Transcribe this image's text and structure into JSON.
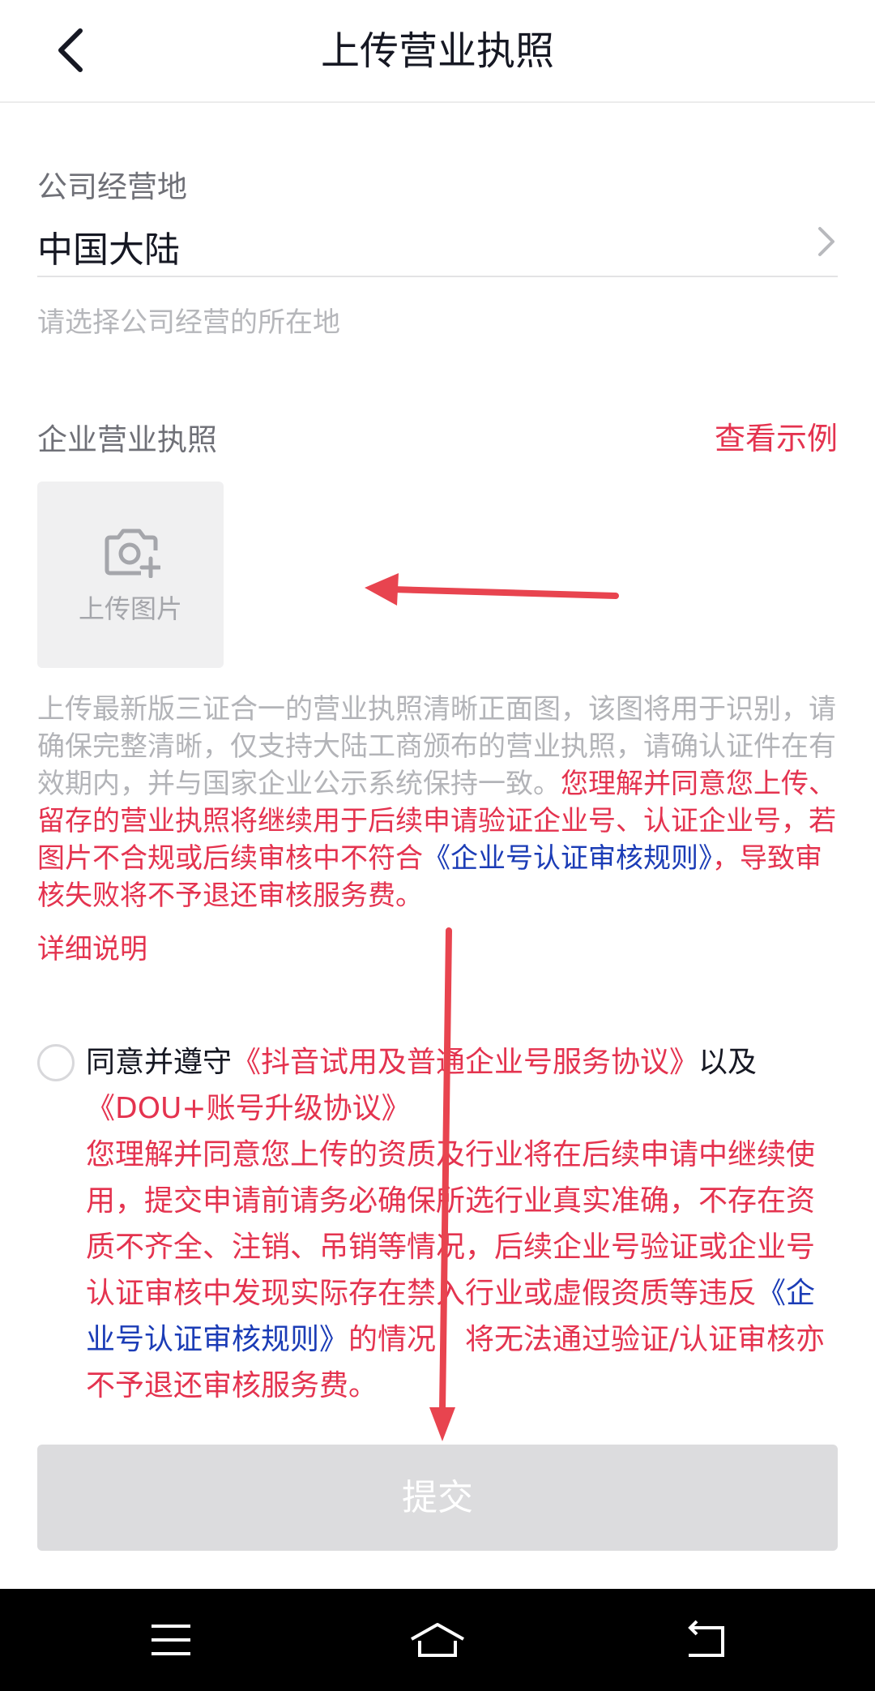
{
  "header": {
    "title": "上传营业执照",
    "back_icon": "chevron-left-icon"
  },
  "location": {
    "label": "公司经营地",
    "value": "中国大陆",
    "hint": "请选择公司经营的所在地"
  },
  "license": {
    "label": "企业营业执照",
    "example_link": "查看示例",
    "upload_label": "上传图片",
    "upload_icon": "camera-plus-icon"
  },
  "description": {
    "gray": "上传最新版三证合一的营业执照清晰正面图，该图将用于识别，请确保完整清晰，仅支持大陆工商颁布的营业执照，请确认证件在有效期内，并与国家企业公示系统保持一致。",
    "red_1": "您理解并同意您上传、留存的营业执照将继续用于后续申请验证企业号、认证企业号，若图片不合规或后续审核中不符合",
    "rules_link": "《企业号认证审核规则》",
    "red_2": "，导致审核失败将不予退还审核服务费。",
    "detail_link": "详细说明"
  },
  "agreement": {
    "prefix": "同意并遵守",
    "link_1": "《抖音试用及普通企业号服务协议》",
    "middle": "以及",
    "link_2": "《DOU+账号升级协议》",
    "note_1": "您理解并同意您上传的资质及行业将在后续申请中继续使用，提交申请前请务必确保所选行业真实准确，不存在资质不齐全、注销、吊销等情况，后续企业号验证或企业号认证审核中发现实际存在禁入行业或虚假资质等违反",
    "rules_link": "《企业号认证审核规则》",
    "note_2": "的情况，将无法通过验证/认证审核亦不予退还审核服务费。"
  },
  "submit": {
    "label": "提交"
  },
  "nav": {
    "menu_icon": "menu-icon",
    "home_icon": "home-icon",
    "back_icon": "back-icon"
  },
  "colors": {
    "accent": "#e4334f",
    "link_blue": "#1b3cb6",
    "annotation_arrow": "#e8444f"
  }
}
